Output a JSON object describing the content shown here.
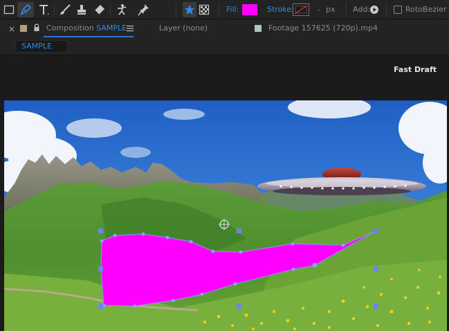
{
  "toolbar": {
    "fill_label": "Fill:",
    "stroke_label": "Stroke:",
    "stroke_width_dash": "-",
    "stroke_width_unit": "px",
    "add_label": "Add:",
    "rotobezier_label": "RotoBezier",
    "fill_color": "#ff00ff",
    "accent_color": "#2d8ceb"
  },
  "tabs": {
    "composition_prefix": "Composition",
    "composition_name": "SAMPLE",
    "layer": "Layer (none)",
    "footage": "Footage  157625 (720p).mp4"
  },
  "breadcrumb": "SAMPLE",
  "viewer": {
    "fast_draft": "Fast Draft",
    "mask_color": "#ff00ff",
    "handle_color": "#6f82ee"
  }
}
